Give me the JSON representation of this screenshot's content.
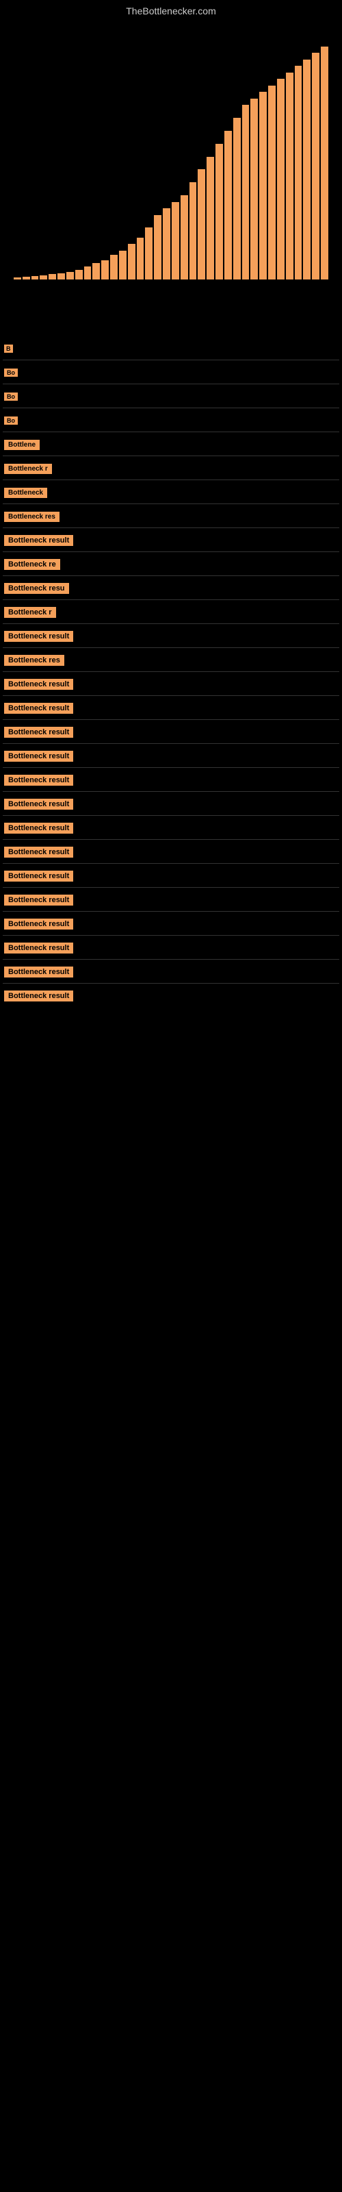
{
  "site": {
    "title": "TheBottlenecker.com"
  },
  "results": [
    {
      "id": 1,
      "label": "B",
      "width_class": "xs"
    },
    {
      "id": 2,
      "label": "Bo",
      "width_class": "xs"
    },
    {
      "id": 3,
      "label": "Bo",
      "width_class": "xs"
    },
    {
      "id": 4,
      "label": "Bo",
      "width_class": "xs"
    },
    {
      "id": 5,
      "label": "Bottlene",
      "width_class": "sm"
    },
    {
      "id": 6,
      "label": "Bottleneck r",
      "width_class": "md"
    },
    {
      "id": 7,
      "label": "Bottleneck",
      "width_class": "sm"
    },
    {
      "id": 8,
      "label": "Bottleneck res",
      "width_class": "md"
    },
    {
      "id": 9,
      "label": "Bottleneck result",
      "width_class": "full"
    },
    {
      "id": 10,
      "label": "Bottleneck re",
      "width_class": "md"
    },
    {
      "id": 11,
      "label": "Bottleneck resu",
      "width_class": "lg"
    },
    {
      "id": 12,
      "label": "Bottleneck r",
      "width_class": "md"
    },
    {
      "id": 13,
      "label": "Bottleneck result",
      "width_class": "full"
    },
    {
      "id": 14,
      "label": "Bottleneck res",
      "width_class": "md"
    },
    {
      "id": 15,
      "label": "Bottleneck result",
      "width_class": "full"
    },
    {
      "id": 16,
      "label": "Bottleneck result",
      "width_class": "full"
    },
    {
      "id": 17,
      "label": "Bottleneck result",
      "width_class": "full"
    },
    {
      "id": 18,
      "label": "Bottleneck result",
      "width_class": "full"
    },
    {
      "id": 19,
      "label": "Bottleneck result",
      "width_class": "full"
    },
    {
      "id": 20,
      "label": "Bottleneck result",
      "width_class": "full"
    },
    {
      "id": 21,
      "label": "Bottleneck result",
      "width_class": "full"
    },
    {
      "id": 22,
      "label": "Bottleneck result",
      "width_class": "full"
    },
    {
      "id": 23,
      "label": "Bottleneck result",
      "width_class": "full"
    },
    {
      "id": 24,
      "label": "Bottleneck result",
      "width_class": "full"
    },
    {
      "id": 25,
      "label": "Bottleneck result",
      "width_class": "full"
    },
    {
      "id": 26,
      "label": "Bottleneck result",
      "width_class": "full"
    },
    {
      "id": 27,
      "label": "Bottleneck result",
      "width_class": "full"
    },
    {
      "id": 28,
      "label": "Bottleneck result",
      "width_class": "full"
    }
  ],
  "bars": [
    3,
    4,
    5,
    6,
    8,
    10,
    12,
    15,
    20,
    25,
    30,
    38,
    45,
    55,
    65,
    80,
    100,
    110,
    120,
    130,
    150,
    170,
    190,
    210,
    230,
    250,
    270,
    280,
    290,
    300,
    310,
    320,
    330,
    340,
    350,
    360
  ]
}
